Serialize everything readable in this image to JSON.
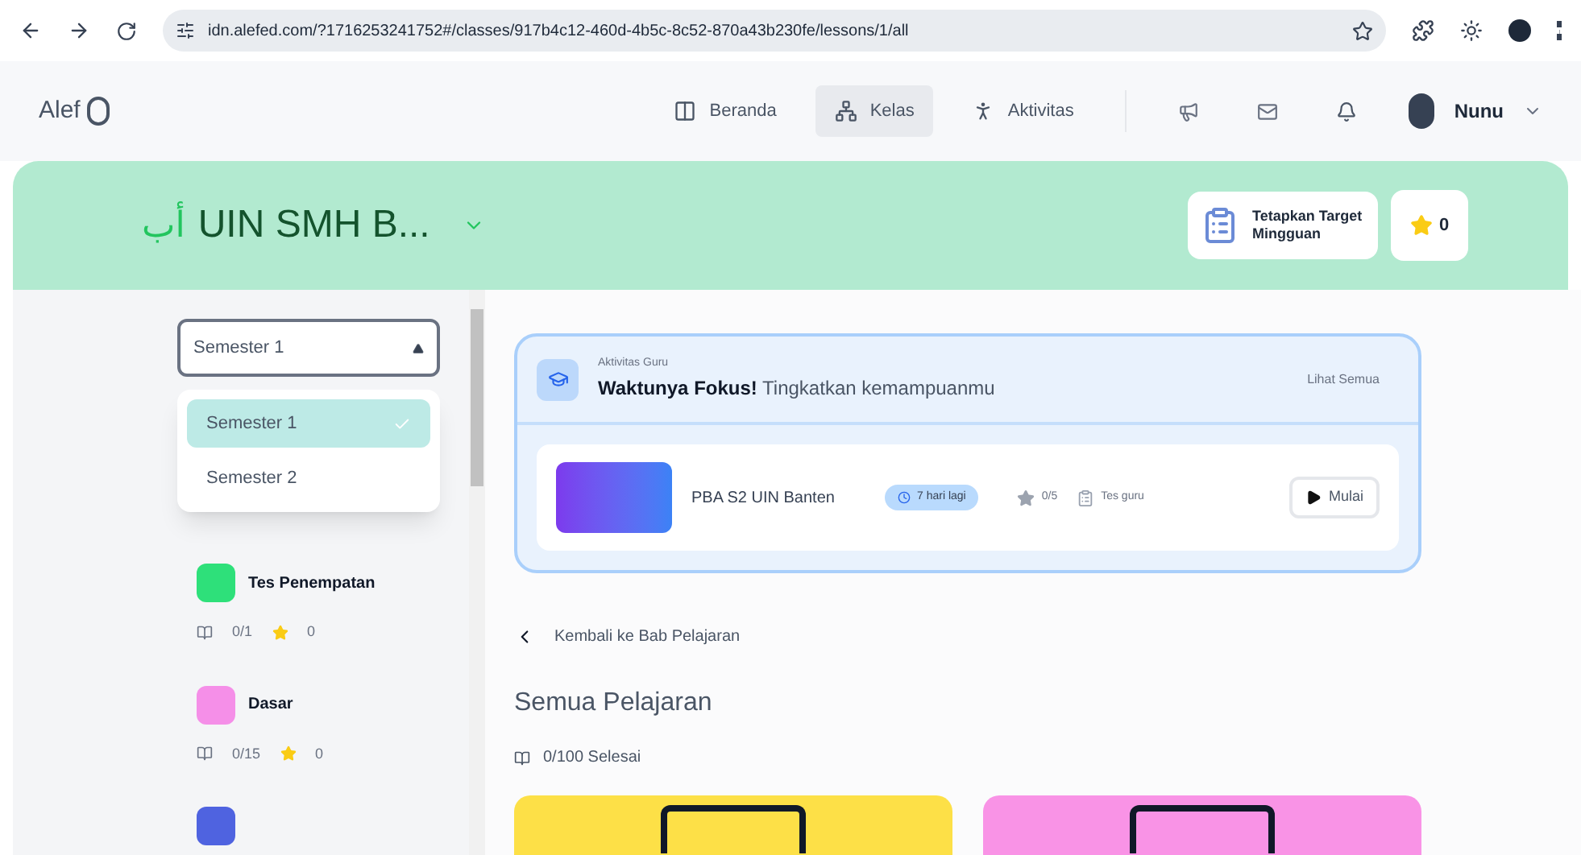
{
  "browser": {
    "url": "idn.alefed.com/?1716253241752#/classes/917b4c12-460d-4b5c-8c52-870a43b230fe/lessons/1/all"
  },
  "nav": {
    "logo": "Alef",
    "items": [
      {
        "label": "Beranda",
        "kind": "home",
        "selected": false
      },
      {
        "label": "Kelas",
        "kind": "class",
        "selected": true
      },
      {
        "label": "Aktivitas",
        "kind": "activity",
        "selected": false
      }
    ],
    "user": "Nunu"
  },
  "header": {
    "arabic": "أب",
    "title": "UIN SMH B...",
    "target_button": "Tetapkan Target Mingguan",
    "stars": "0"
  },
  "sidebar": {
    "select": {
      "value": "Semester 1",
      "expanded": true
    },
    "options": [
      {
        "label": "Semester 1",
        "selected": true
      },
      {
        "label": "Semester 2",
        "selected": false
      }
    ],
    "chapters": [
      {
        "title": "Tes Penempatan",
        "color": "#2ee07a",
        "progress": "0/1",
        "stars": "0"
      },
      {
        "title": "Dasar",
        "color": "#f58fe8",
        "progress": "0/15",
        "stars": "0"
      }
    ]
  },
  "activity": {
    "label": "Aktivitas Guru",
    "title": "Waktunya Fokus!",
    "subtitle": "Tingkatkan kemampuanmu",
    "see_all": "Lihat Semua",
    "item": {
      "name": "PBA S2 UIN Banten",
      "due": "7 hari lagi",
      "score": "0/5",
      "type": "Tes guru",
      "button": "Mulai"
    }
  },
  "back_link": "Kembali ke Bab Pelajaran",
  "heading": "Semua Pelajaran",
  "progress": "0/100 Selesai",
  "lesson_cards": [
    {
      "color": "#fde047"
    },
    {
      "color": "#f993e6"
    }
  ]
}
